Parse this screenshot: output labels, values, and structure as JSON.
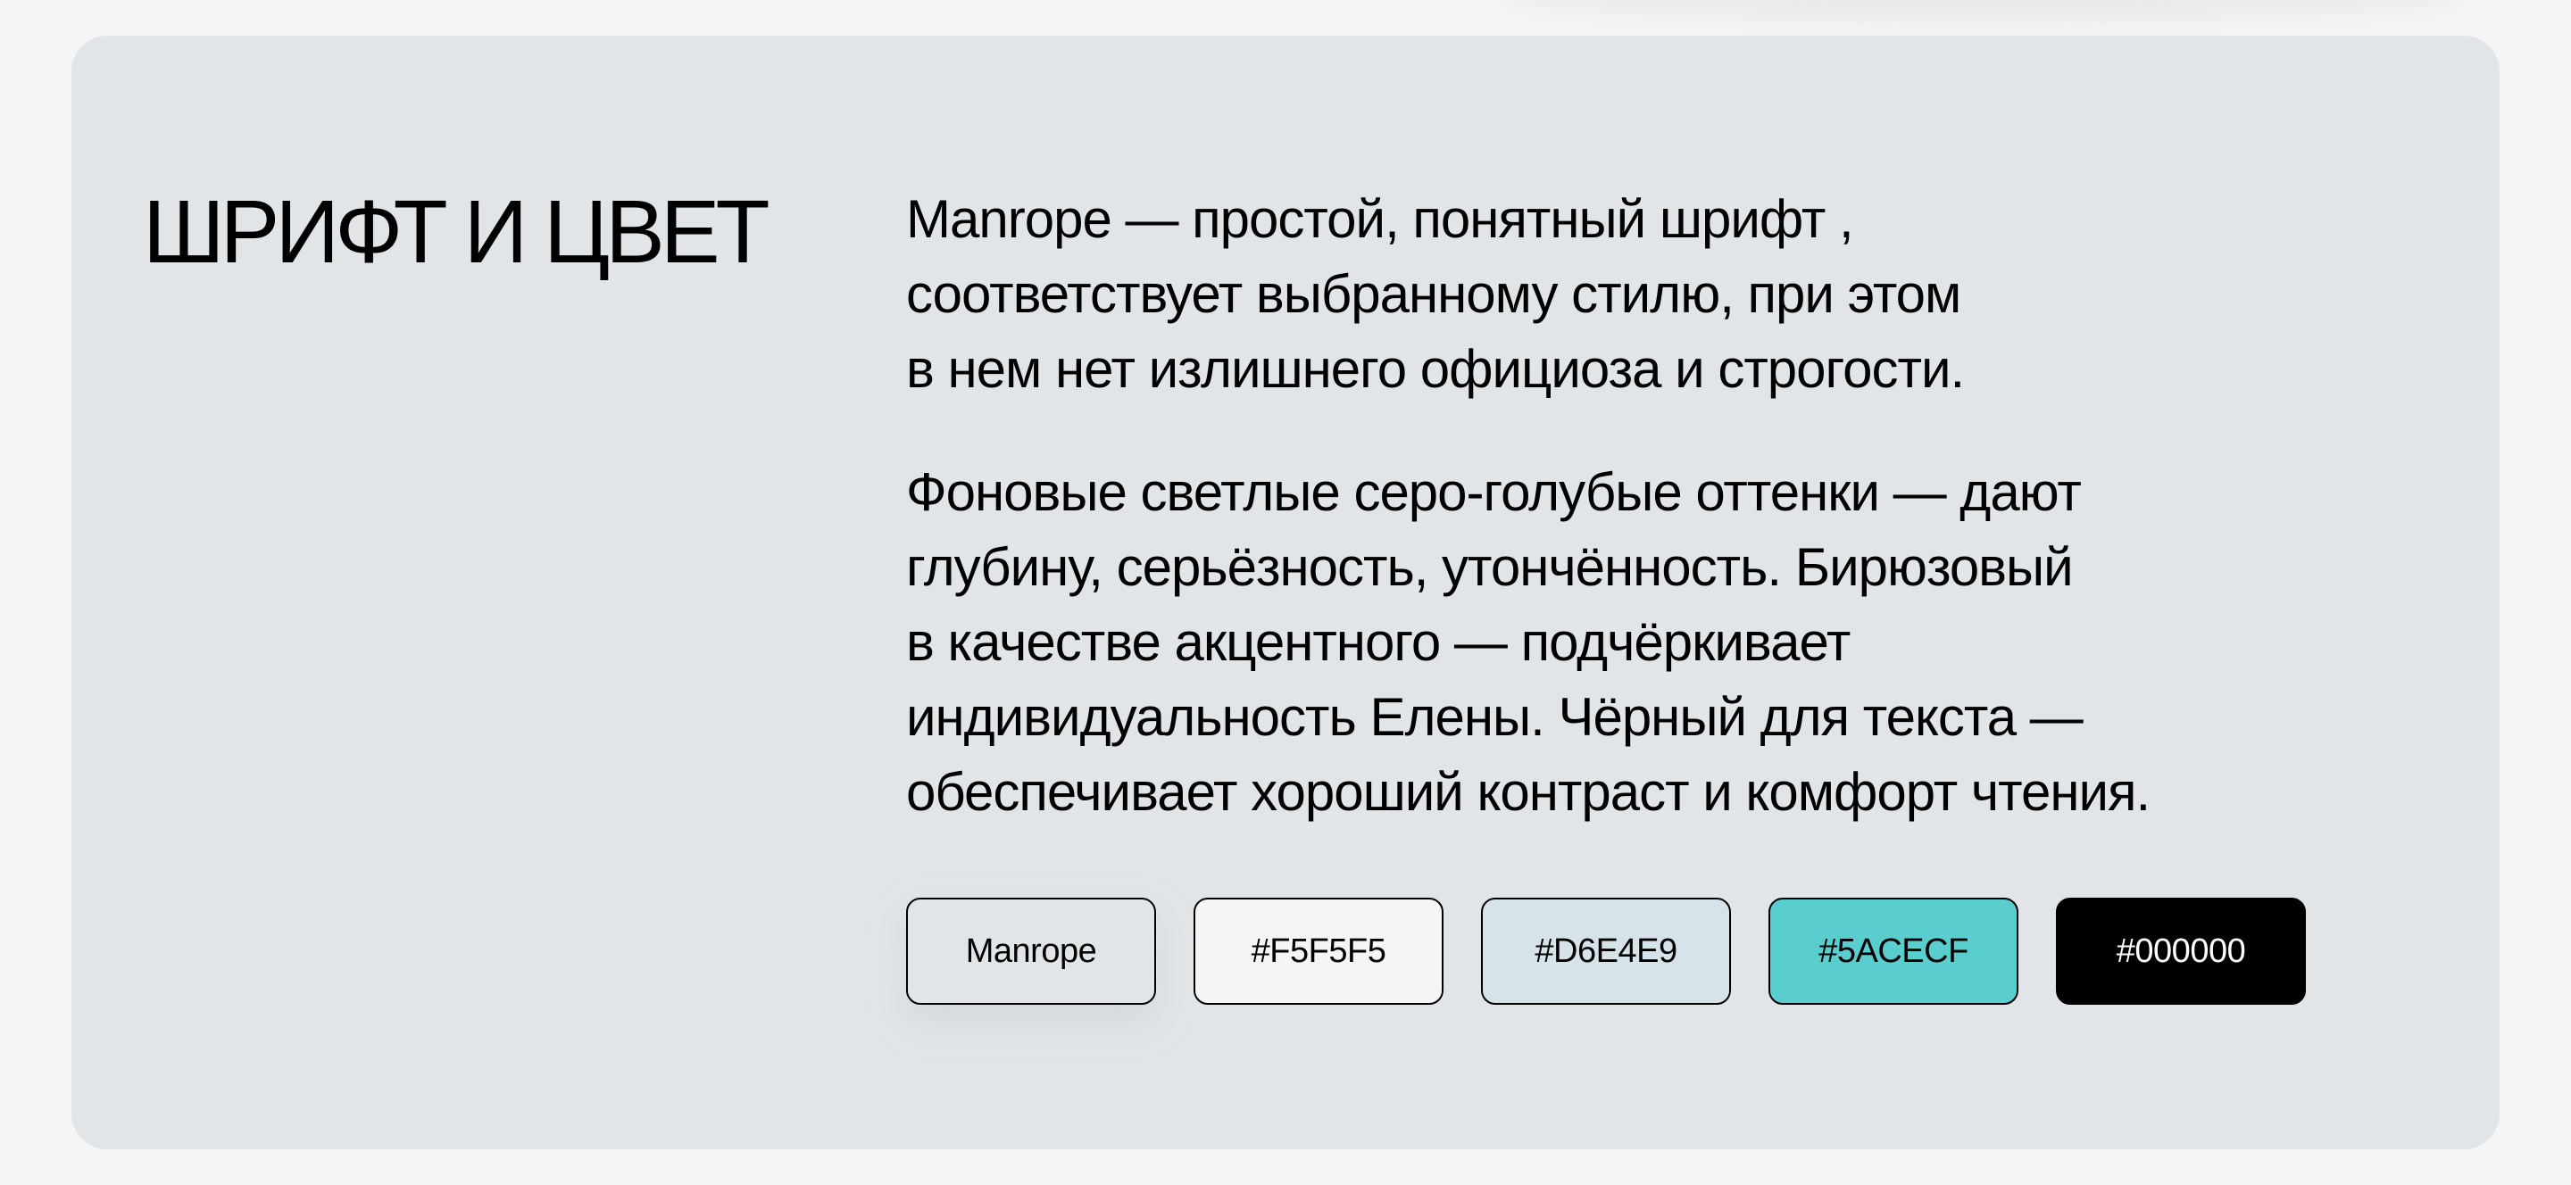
{
  "section": {
    "title": "ШРИФТ И ЦВЕТ",
    "paragraphs": [
      "Manrope — простой, понятный шрифт ,\nсоответствует выбранному стилю, при этом\nв нем нет излишнего официоза и строгости.",
      "Фоновые светлые серо-голубые оттенки — дают\nглубину, серьёзность, утончённость. Бирюзовый\nв качестве акцентного — подчёркивает\nиндивидуальность Елены. Чёрный для текста —\nобеспечивает хороший контраст и комфорт чтения."
    ]
  },
  "swatches": [
    {
      "label": "Manrope",
      "color": "#E2E5E8"
    },
    {
      "label": "#F5F5F5",
      "color": "#F5F5F5"
    },
    {
      "label": "#D6E4E9",
      "color": "#D6E4E9"
    },
    {
      "label": "#5ACECF",
      "color": "#5ACECF"
    },
    {
      "label": "#000000",
      "color": "#000000"
    }
  ],
  "colors": {
    "page_background": "#F5F5F5",
    "card_background": "#E2E5E8",
    "accent": "#5ACECF",
    "text": "#000000"
  }
}
